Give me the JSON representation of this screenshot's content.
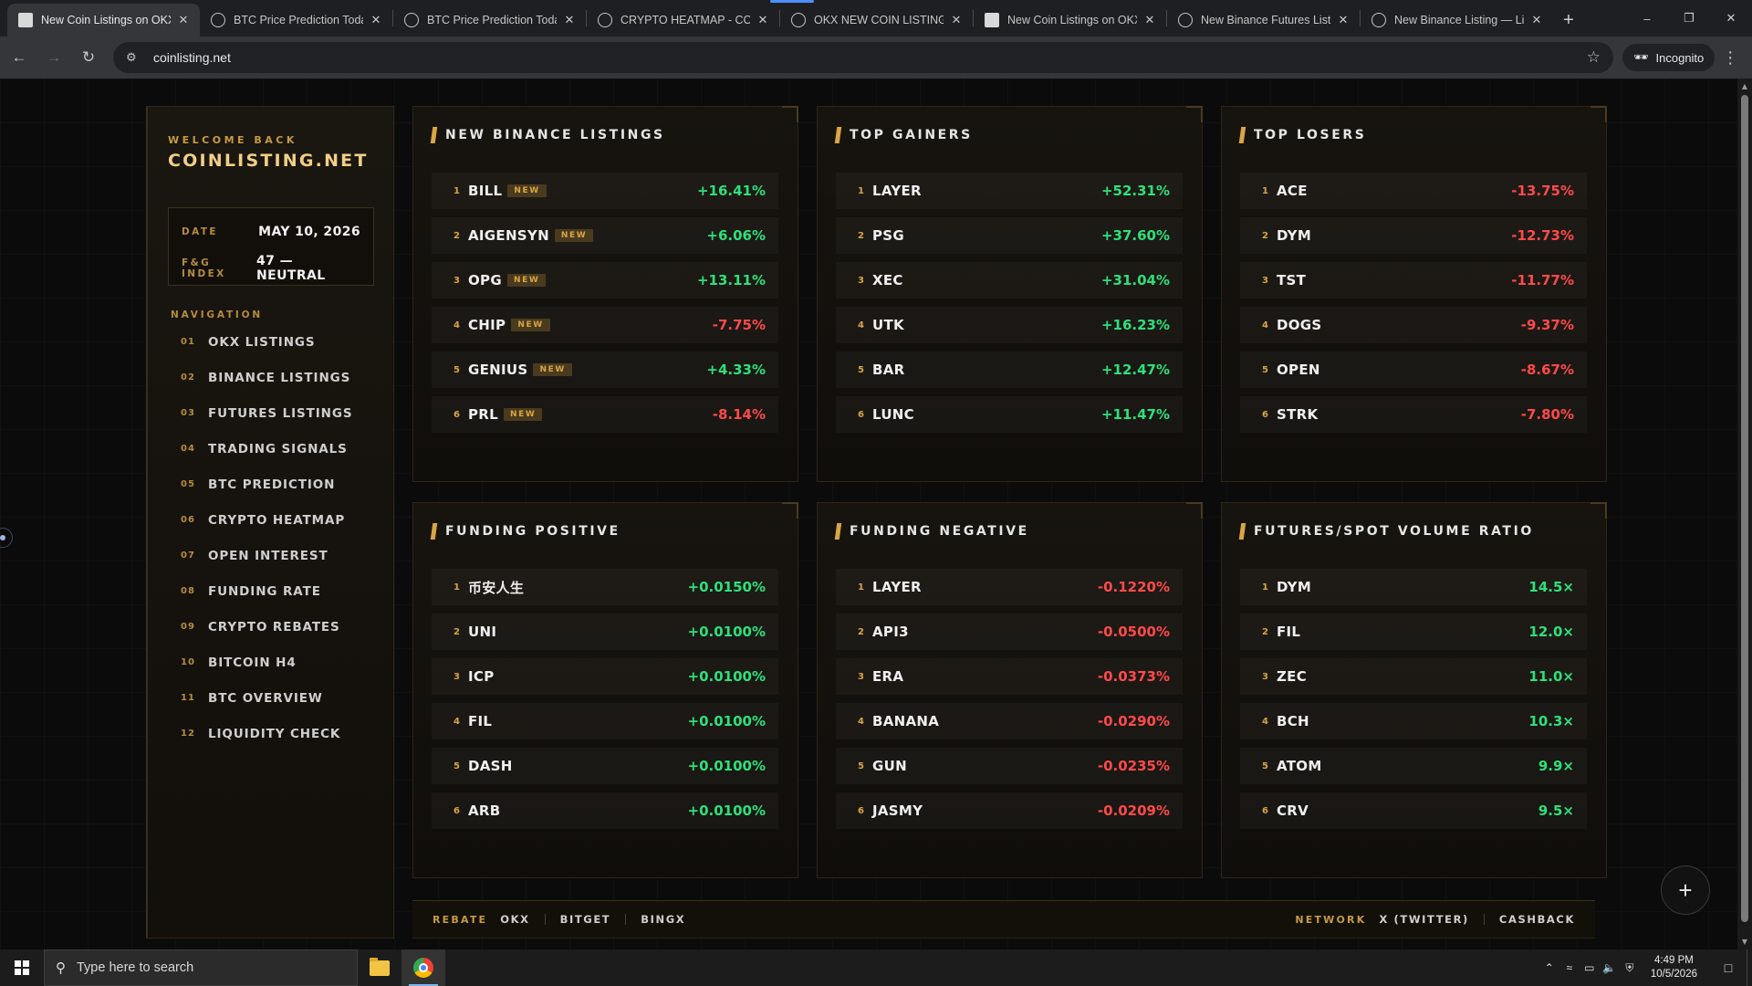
{
  "browser": {
    "tabs": [
      {
        "title": "New Coin Listings on OKX",
        "active": true,
        "icon": "doc-icon"
      },
      {
        "title": "BTC Price Prediction Today",
        "icon": "globe-icon"
      },
      {
        "title": "BTC Price Prediction Today",
        "icon": "globe-icon"
      },
      {
        "title": "CRYPTO HEATMAP - COIN",
        "icon": "globe-icon"
      },
      {
        "title": "OKX NEW COIN LISTINGS",
        "icon": "globe-icon"
      },
      {
        "title": "New Coin Listings on OKX",
        "icon": "doc-icon"
      },
      {
        "title": "New Binance Futures Listi",
        "icon": "globe-icon"
      },
      {
        "title": "New Binance Listing — Liv",
        "icon": "globe-icon"
      }
    ],
    "url": "coinlisting.net",
    "incognito_label": "Incognito"
  },
  "sidebar": {
    "welcome": "WELCOME BACK",
    "brand": "COINLISTING.NET",
    "date_label": "DATE",
    "date_value": "MAY 10, 2026",
    "fg_label": "F&G INDEX",
    "fg_value": "47 — NEUTRAL",
    "nav_heading": "NAVIGATION",
    "nav": [
      {
        "num": "01",
        "label": "OKX LISTINGS"
      },
      {
        "num": "02",
        "label": "BINANCE LISTINGS"
      },
      {
        "num": "03",
        "label": "FUTURES LISTINGS"
      },
      {
        "num": "04",
        "label": "TRADING SIGNALS"
      },
      {
        "num": "05",
        "label": "BTC PREDICTION"
      },
      {
        "num": "06",
        "label": "CRYPTO HEATMAP"
      },
      {
        "num": "07",
        "label": "OPEN INTEREST"
      },
      {
        "num": "08",
        "label": "FUNDING RATE"
      },
      {
        "num": "09",
        "label": "CRYPTO REBATES"
      },
      {
        "num": "10",
        "label": "BITCOIN H4"
      },
      {
        "num": "11",
        "label": "BTC OVERVIEW"
      },
      {
        "num": "12",
        "label": "LIQUIDITY CHECK"
      }
    ]
  },
  "panels": [
    {
      "id": "new-binance-listings",
      "title": "NEW BINANCE LISTINGS",
      "rows": [
        {
          "rank": "1",
          "symbol": "BILL",
          "badge": "NEW",
          "value": "+16.41%",
          "dir": "up"
        },
        {
          "rank": "2",
          "symbol": "AIGENSYN",
          "badge": "NEW",
          "value": "+6.06%",
          "dir": "up"
        },
        {
          "rank": "3",
          "symbol": "OPG",
          "badge": "NEW",
          "value": "+13.11%",
          "dir": "up"
        },
        {
          "rank": "4",
          "symbol": "CHIP",
          "badge": "NEW",
          "value": "-7.75%",
          "dir": "dn"
        },
        {
          "rank": "5",
          "symbol": "GENIUS",
          "badge": "NEW",
          "value": "+4.33%",
          "dir": "up"
        },
        {
          "rank": "6",
          "symbol": "PRL",
          "badge": "NEW",
          "value": "-8.14%",
          "dir": "dn"
        }
      ]
    },
    {
      "id": "top-gainers",
      "title": "TOP GAINERS",
      "rows": [
        {
          "rank": "1",
          "symbol": "LAYER",
          "value": "+52.31%",
          "dir": "up"
        },
        {
          "rank": "2",
          "symbol": "PSG",
          "value": "+37.60%",
          "dir": "up"
        },
        {
          "rank": "3",
          "symbol": "XEC",
          "value": "+31.04%",
          "dir": "up"
        },
        {
          "rank": "4",
          "symbol": "UTK",
          "value": "+16.23%",
          "dir": "up"
        },
        {
          "rank": "5",
          "symbol": "BAR",
          "value": "+12.47%",
          "dir": "up"
        },
        {
          "rank": "6",
          "symbol": "LUNC",
          "value": "+11.47%",
          "dir": "up"
        }
      ]
    },
    {
      "id": "top-losers",
      "title": "TOP LOSERS",
      "rows": [
        {
          "rank": "1",
          "symbol": "ACE",
          "value": "-13.75%",
          "dir": "dn"
        },
        {
          "rank": "2",
          "symbol": "DYM",
          "value": "-12.73%",
          "dir": "dn"
        },
        {
          "rank": "3",
          "symbol": "TST",
          "value": "-11.77%",
          "dir": "dn"
        },
        {
          "rank": "4",
          "symbol": "DOGS",
          "value": "-9.37%",
          "dir": "dn"
        },
        {
          "rank": "5",
          "symbol": "OPEN",
          "value": "-8.67%",
          "dir": "dn"
        },
        {
          "rank": "6",
          "symbol": "STRK",
          "value": "-7.80%",
          "dir": "dn"
        }
      ]
    },
    {
      "id": "funding-positive",
      "title": "FUNDING POSITIVE",
      "rows": [
        {
          "rank": "1",
          "symbol": "币安人生",
          "value": "+0.0150%",
          "dir": "up"
        },
        {
          "rank": "2",
          "symbol": "UNI",
          "value": "+0.0100%",
          "dir": "up"
        },
        {
          "rank": "3",
          "symbol": "ICP",
          "value": "+0.0100%",
          "dir": "up"
        },
        {
          "rank": "4",
          "symbol": "FIL",
          "value": "+0.0100%",
          "dir": "up"
        },
        {
          "rank": "5",
          "symbol": "DASH",
          "value": "+0.0100%",
          "dir": "up"
        },
        {
          "rank": "6",
          "symbol": "ARB",
          "value": "+0.0100%",
          "dir": "up"
        }
      ]
    },
    {
      "id": "funding-negative",
      "title": "FUNDING NEGATIVE",
      "rows": [
        {
          "rank": "1",
          "symbol": "LAYER",
          "value": "-0.1220%",
          "dir": "dn"
        },
        {
          "rank": "2",
          "symbol": "API3",
          "value": "-0.0500%",
          "dir": "dn"
        },
        {
          "rank": "3",
          "symbol": "ERA",
          "value": "-0.0373%",
          "dir": "dn"
        },
        {
          "rank": "4",
          "symbol": "BANANA",
          "value": "-0.0290%",
          "dir": "dn"
        },
        {
          "rank": "5",
          "symbol": "GUN",
          "value": "-0.0235%",
          "dir": "dn"
        },
        {
          "rank": "6",
          "symbol": "JASMY",
          "value": "-0.0209%",
          "dir": "dn"
        }
      ]
    },
    {
      "id": "futures-spot-volume-ratio",
      "title": "FUTURES/SPOT VOLUME RATIO",
      "rows": [
        {
          "rank": "1",
          "symbol": "DYM",
          "value": "14.5×",
          "dir": "up"
        },
        {
          "rank": "2",
          "symbol": "FIL",
          "value": "12.0×",
          "dir": "up"
        },
        {
          "rank": "3",
          "symbol": "ZEC",
          "value": "11.0×",
          "dir": "up"
        },
        {
          "rank": "4",
          "symbol": "BCH",
          "value": "10.3×",
          "dir": "up"
        },
        {
          "rank": "5",
          "symbol": "ATOM",
          "value": "9.9×",
          "dir": "up"
        },
        {
          "rank": "6",
          "symbol": "CRV",
          "value": "9.5×",
          "dir": "up"
        }
      ]
    }
  ],
  "footer": {
    "rebate_label": "REBATE",
    "rebate_links": [
      "OKX",
      "BITGET",
      "BINGX"
    ],
    "network_label": "NETWORK",
    "network_links": [
      "X (TWITTER)",
      "CASHBACK"
    ]
  },
  "taskbar": {
    "search_placeholder": "Type here to search",
    "time": "4:49 PM",
    "date": "10/5/2026"
  },
  "colors": {
    "accent_gold": "#d9a545",
    "positive": "#2ee07a",
    "negative": "#ff4a4a"
  }
}
